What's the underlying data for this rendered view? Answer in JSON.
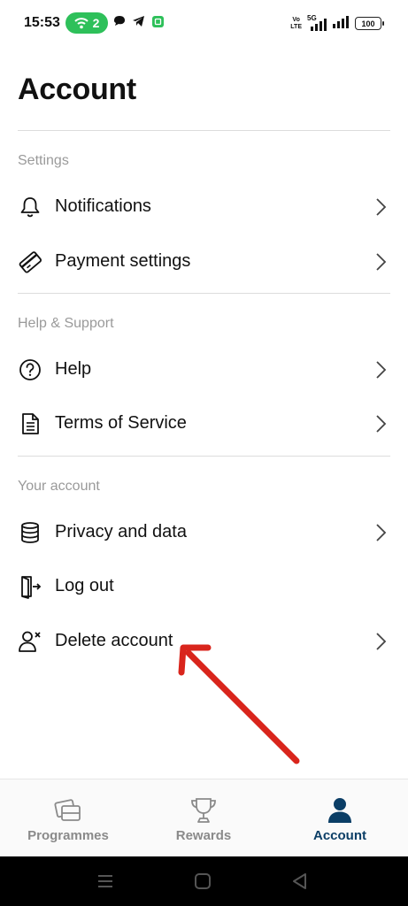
{
  "status_bar": {
    "time": "15:53",
    "hotspot_count": "2",
    "network_label_top": "Vo",
    "network_label_bottom": "LTE",
    "network_gen": "5G",
    "battery": "100"
  },
  "page": {
    "title": "Account"
  },
  "sections": [
    {
      "header": "Settings",
      "items": [
        {
          "label": "Notifications",
          "icon": "bell-icon"
        },
        {
          "label": "Payment settings",
          "icon": "credit-card-icon"
        }
      ]
    },
    {
      "header": "Help & Support",
      "items": [
        {
          "label": "Help",
          "icon": "question-circle-icon"
        },
        {
          "label": "Terms of Service",
          "icon": "document-icon"
        }
      ]
    },
    {
      "header": "Your account",
      "items": [
        {
          "label": "Privacy and data",
          "icon": "database-icon"
        },
        {
          "label": "Log out",
          "icon": "logout-icon"
        },
        {
          "label": "Delete account",
          "icon": "user-remove-icon"
        }
      ]
    }
  ],
  "bottom_nav": {
    "items": [
      {
        "label": "Programmes",
        "icon": "cards-icon",
        "active": false
      },
      {
        "label": "Rewards",
        "icon": "trophy-icon",
        "active": false
      },
      {
        "label": "Account",
        "icon": "person-icon",
        "active": true
      }
    ]
  },
  "colors": {
    "accent": "#0b3e66",
    "hotspot_pill": "#2ec05a",
    "annotation_arrow": "#d9251c",
    "section_header": "#9a9a9a"
  }
}
